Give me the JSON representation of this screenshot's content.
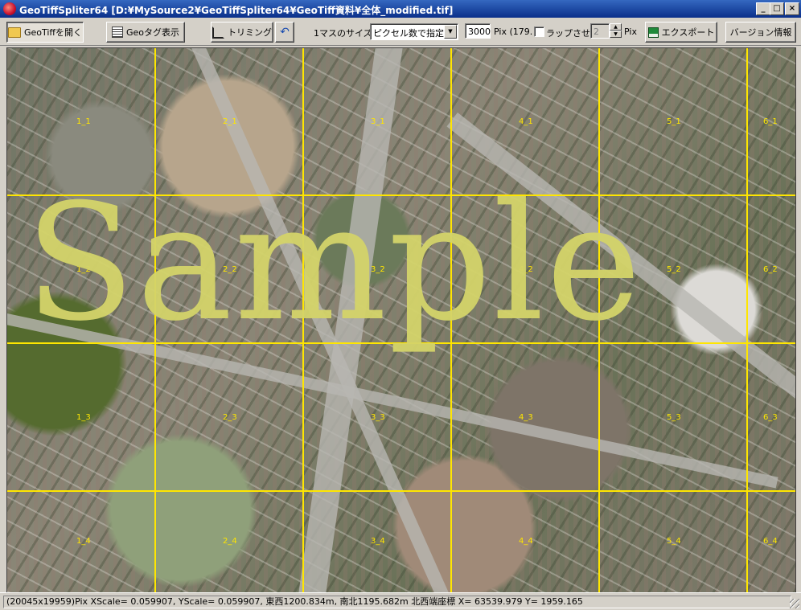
{
  "window": {
    "title": "GeoTiffSpliter64 [D:¥MySource2¥GeoTiffSpliter64¥GeoTiff資料¥全体_modified.tif]",
    "minimize": "_",
    "maximize": "□",
    "close": "×"
  },
  "toolbar": {
    "open_label": "GeoTiffを開く",
    "geotag_label": "Geoタグ表示",
    "trim_label": "トリミング",
    "undo_icon": "↶",
    "cell_size_label": "1マスのサイズ:",
    "cell_size_mode": "ピクセル数で指定",
    "pixel_value": "3000",
    "pixel_unit": "Pix (179.",
    "wrap_label": "ラップさせる",
    "wrap_checked": false,
    "wrap_value": "2",
    "wrap_unit": "Pix",
    "export_label": "エクスポート",
    "version_label": "バージョン情報"
  },
  "map": {
    "watermark": "Sample",
    "grid_color": "#ffe600",
    "cell_labels": [
      "1_1",
      "2_1",
      "3_1",
      "4_1",
      "5_1",
      "6_1",
      "1_2",
      "2_2",
      "3_2",
      "4_2",
      "5_2",
      "6_2",
      "1_3",
      "2_3",
      "3_3",
      "4_3",
      "5_3",
      "6_3",
      "1_4",
      "2_4",
      "3_4",
      "4_4",
      "5_4",
      "6_4"
    ]
  },
  "status": {
    "text": "(20045x19959)Pix  XScale= 0.059907, YScale= 0.059907, 東西1200.834m, 南北1195.682m  北西端座標 X= 63539.979 Y= 1959.165"
  }
}
